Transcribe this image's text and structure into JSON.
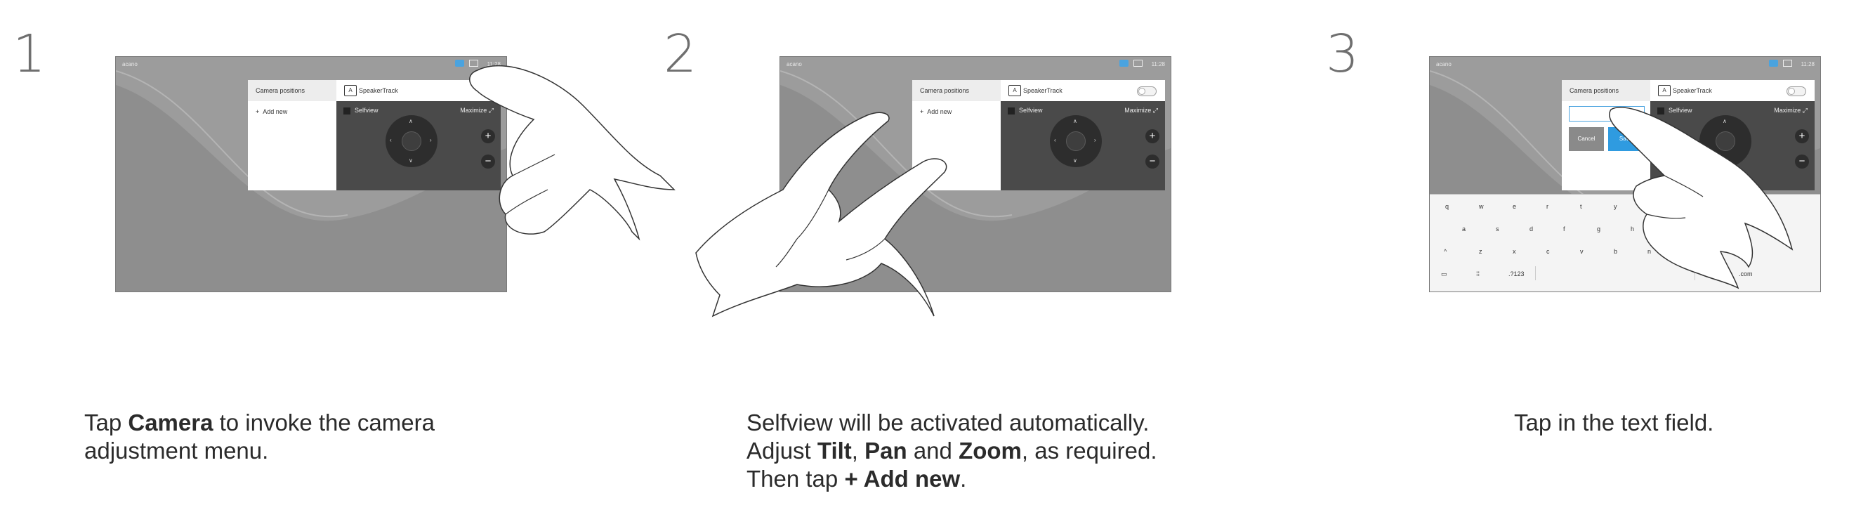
{
  "steps": [
    {
      "number": "1",
      "screen": {
        "brand": "acano",
        "clock": "11:28",
        "panel": {
          "side_header": "Camera positions",
          "add_new": "Add new",
          "speakertrack": "SpeakerTrack",
          "selfview": "Selfview",
          "maximize": "Maximize"
        }
      },
      "caption": {
        "t1": "Tap ",
        "b1": "Camera",
        "t2": " to invoke the camera",
        "t3": "adjustment menu."
      }
    },
    {
      "number": "2",
      "screen": {
        "brand": "acano",
        "clock": "11:28",
        "panel": {
          "side_header": "Camera positions",
          "add_new": "Add new",
          "speakertrack": "SpeakerTrack",
          "selfview": "Selfview",
          "maximize": "Maximize"
        }
      },
      "caption": {
        "l1": "Selfview will be activated automatically.",
        "l2a": "Adjust ",
        "l2b": "Tilt",
        "l2c": ", ",
        "l2d": "Pan",
        "l2e": " and ",
        "l2f": "Zoom",
        "l2g": ", as required.",
        "l3a": "Then tap ",
        "l3b": "+ Add new",
        "l3c": "."
      }
    },
    {
      "number": "3",
      "screen": {
        "brand": "acano",
        "clock": "11:28",
        "panel": {
          "side_header": "Camera positions",
          "cancel": "Cancel",
          "save": "Save",
          "speakertrack": "SpeakerTrack",
          "selfview": "Selfview",
          "maximize": "Maximize"
        },
        "keyboard": {
          "row1": [
            "q",
            "w",
            "e",
            "r",
            "t",
            "y"
          ],
          "row2": [
            "a",
            "s",
            "d",
            "f",
            "g",
            "h"
          ],
          "row3": [
            "z",
            "x",
            "c",
            "v",
            "b",
            "n"
          ],
          "num": ".?123",
          "at": "@",
          "com": ".com"
        }
      },
      "caption": {
        "t1": "Tap in the text field."
      }
    }
  ],
  "colors": {
    "screen_bg": "#9a9a9a",
    "panel_dark": "#4a4a4a",
    "accent_blue": "#2f9be0"
  }
}
